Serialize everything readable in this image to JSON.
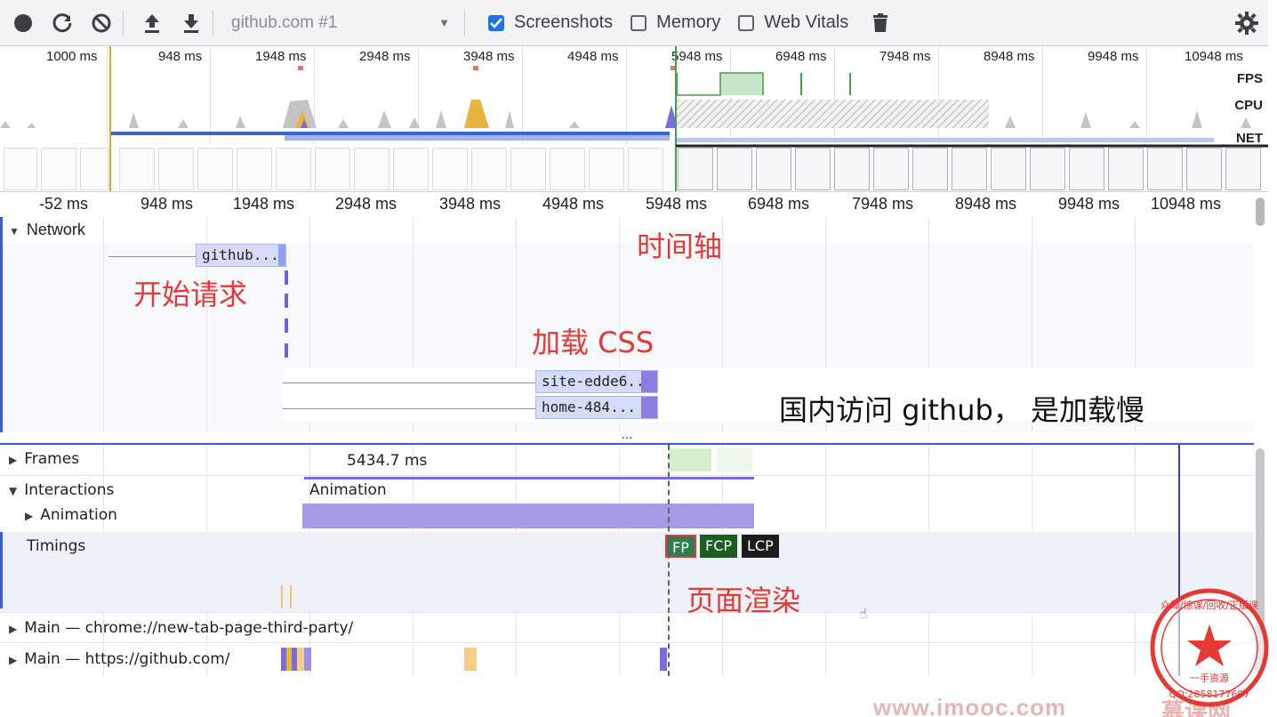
{
  "toolbar": {
    "target": "github.com #1",
    "screenshots_label": "Screenshots",
    "memory_label": "Memory",
    "web_vitals_label": "Web Vitals",
    "screenshots_checked": true,
    "memory_checked": false,
    "web_vitals_checked": false,
    "icons": [
      "record-icon",
      "reload-icon",
      "clear-icon",
      "upload-icon",
      "download-icon",
      "trash-icon",
      "gear-icon"
    ]
  },
  "overview": {
    "ticks": [
      "1000 ms",
      "948 ms",
      "1948 ms",
      "2948 ms",
      "3948 ms",
      "4948 ms",
      "5948 ms",
      "6948 ms",
      "7948 ms",
      "8948 ms",
      "9948 ms",
      "10948 ms"
    ],
    "fps_label": "FPS",
    "cpu_label": "CPU",
    "net_label": "NET"
  },
  "ruler": {
    "ticks": [
      "-52 ms",
      "948 ms",
      "1948 ms",
      "2948 ms",
      "3948 ms",
      "4948 ms",
      "5948 ms",
      "6948 ms",
      "7948 ms",
      "8948 ms",
      "9948 ms",
      "10948 ms"
    ]
  },
  "network": {
    "title": "Network",
    "requests": [
      "github....",
      "site-edde6...",
      "home-484..."
    ]
  },
  "splitter_label": "...",
  "flame": {
    "frames_label": "Frames",
    "frame_duration": "5434.7 ms",
    "interactions_label": "Interactions",
    "interaction_name": "Animation",
    "animation_label": "Animation",
    "timings_label": "Timings",
    "marks": [
      "FP",
      "FCP",
      "LCP"
    ],
    "main1": "Main — chrome://new-tab-page-third-party/",
    "main2": "Main — https://github.com/"
  },
  "annotations": {
    "timeline": "时间轴",
    "start_request": "开始请求",
    "load_css": "加载 CSS",
    "slow_note": "国内访问 github， 是加载慢",
    "render": "页面渲染"
  },
  "watermark": {
    "site": "www.imooc.com",
    "brand": "慕课网",
    "seal_top": "众筹/惊课/回收/正版课",
    "seal_mid": "一手资源",
    "seal_qq": "QQ:2858177607"
  },
  "colors": {
    "accent": "#1a73e8",
    "annotation": "#e53935",
    "request_bar": "#d4dcf7",
    "animation_bar": "#a99ae8",
    "timing_fp": "#2e7d4f",
    "timing_fcp": "#1b5e20",
    "timing_lcp": "#1c1c1c",
    "seal": "#e53935"
  }
}
